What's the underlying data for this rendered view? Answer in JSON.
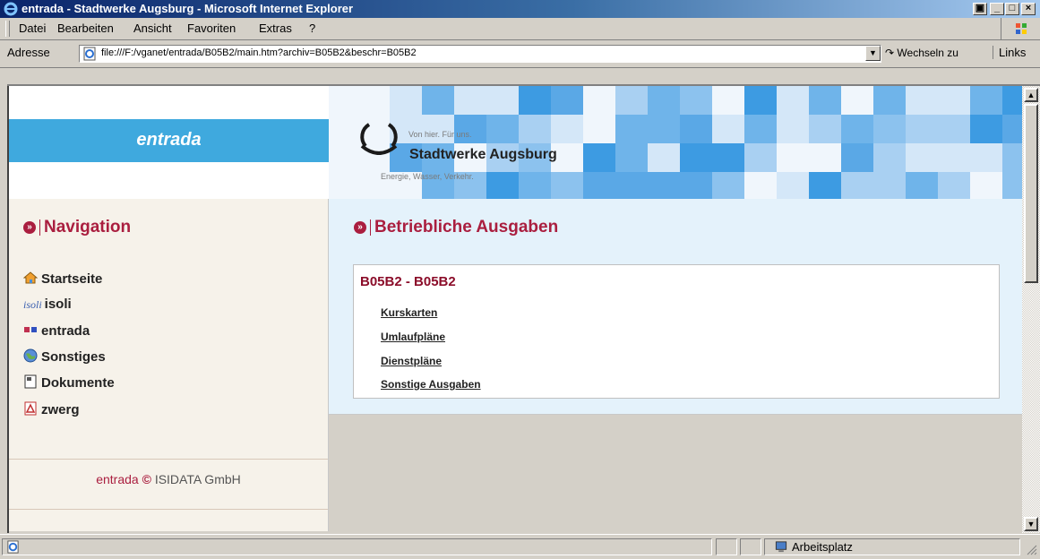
{
  "window": {
    "title": "entrada - Stadtwerke Augsburg - Microsoft Internet Explorer"
  },
  "menu": {
    "items": [
      "Datei",
      "Bearbeiten",
      "Ansicht",
      "Favoriten",
      "Extras",
      "?"
    ]
  },
  "address_bar": {
    "label": "Adresse",
    "url": "file:///F:/vganet/entrada/B05B2/main.htm?archiv=B05B2&beschr=B05B2",
    "go_label": "Wechseln zu",
    "links_label": "Links"
  },
  "header": {
    "app_name": "entrada",
    "logo": {
      "tagline": "Von hier. Für uns.",
      "name": "Stadtwerke Augsburg",
      "subline": "Energie, Wasser, Verkehr."
    }
  },
  "navigation": {
    "heading": "Navigation",
    "items": [
      {
        "label": "Startseite",
        "icon": "home-icon"
      },
      {
        "label": "isoli",
        "icon": "isoli-logo-icon",
        "icon_text": "isoli"
      },
      {
        "label": "entrada",
        "icon": "entrada-logo-icon"
      },
      {
        "label": "Sonstiges",
        "icon": "globe-icon"
      },
      {
        "label": "Dokumente",
        "icon": "document-icon"
      },
      {
        "label": "zwerg",
        "icon": "pdf-icon"
      }
    ],
    "footer_brand": "entrada",
    "footer_copyright": "©",
    "footer_company": "ISIDATA GmbH"
  },
  "main": {
    "heading": "Betriebliche Ausgaben",
    "box_title": "B05B2 - B05B2",
    "links": [
      "Kurskarten",
      "Umlaufpläne",
      "Dienstpläne",
      "Sonstige Ausgaben"
    ]
  },
  "status_bar": {
    "zone": "Arbeitsplatz"
  },
  "colors": {
    "accent_red": "#aa1e3f",
    "header_blue": "#3fa9de",
    "main_bg": "#e4f2fb"
  }
}
